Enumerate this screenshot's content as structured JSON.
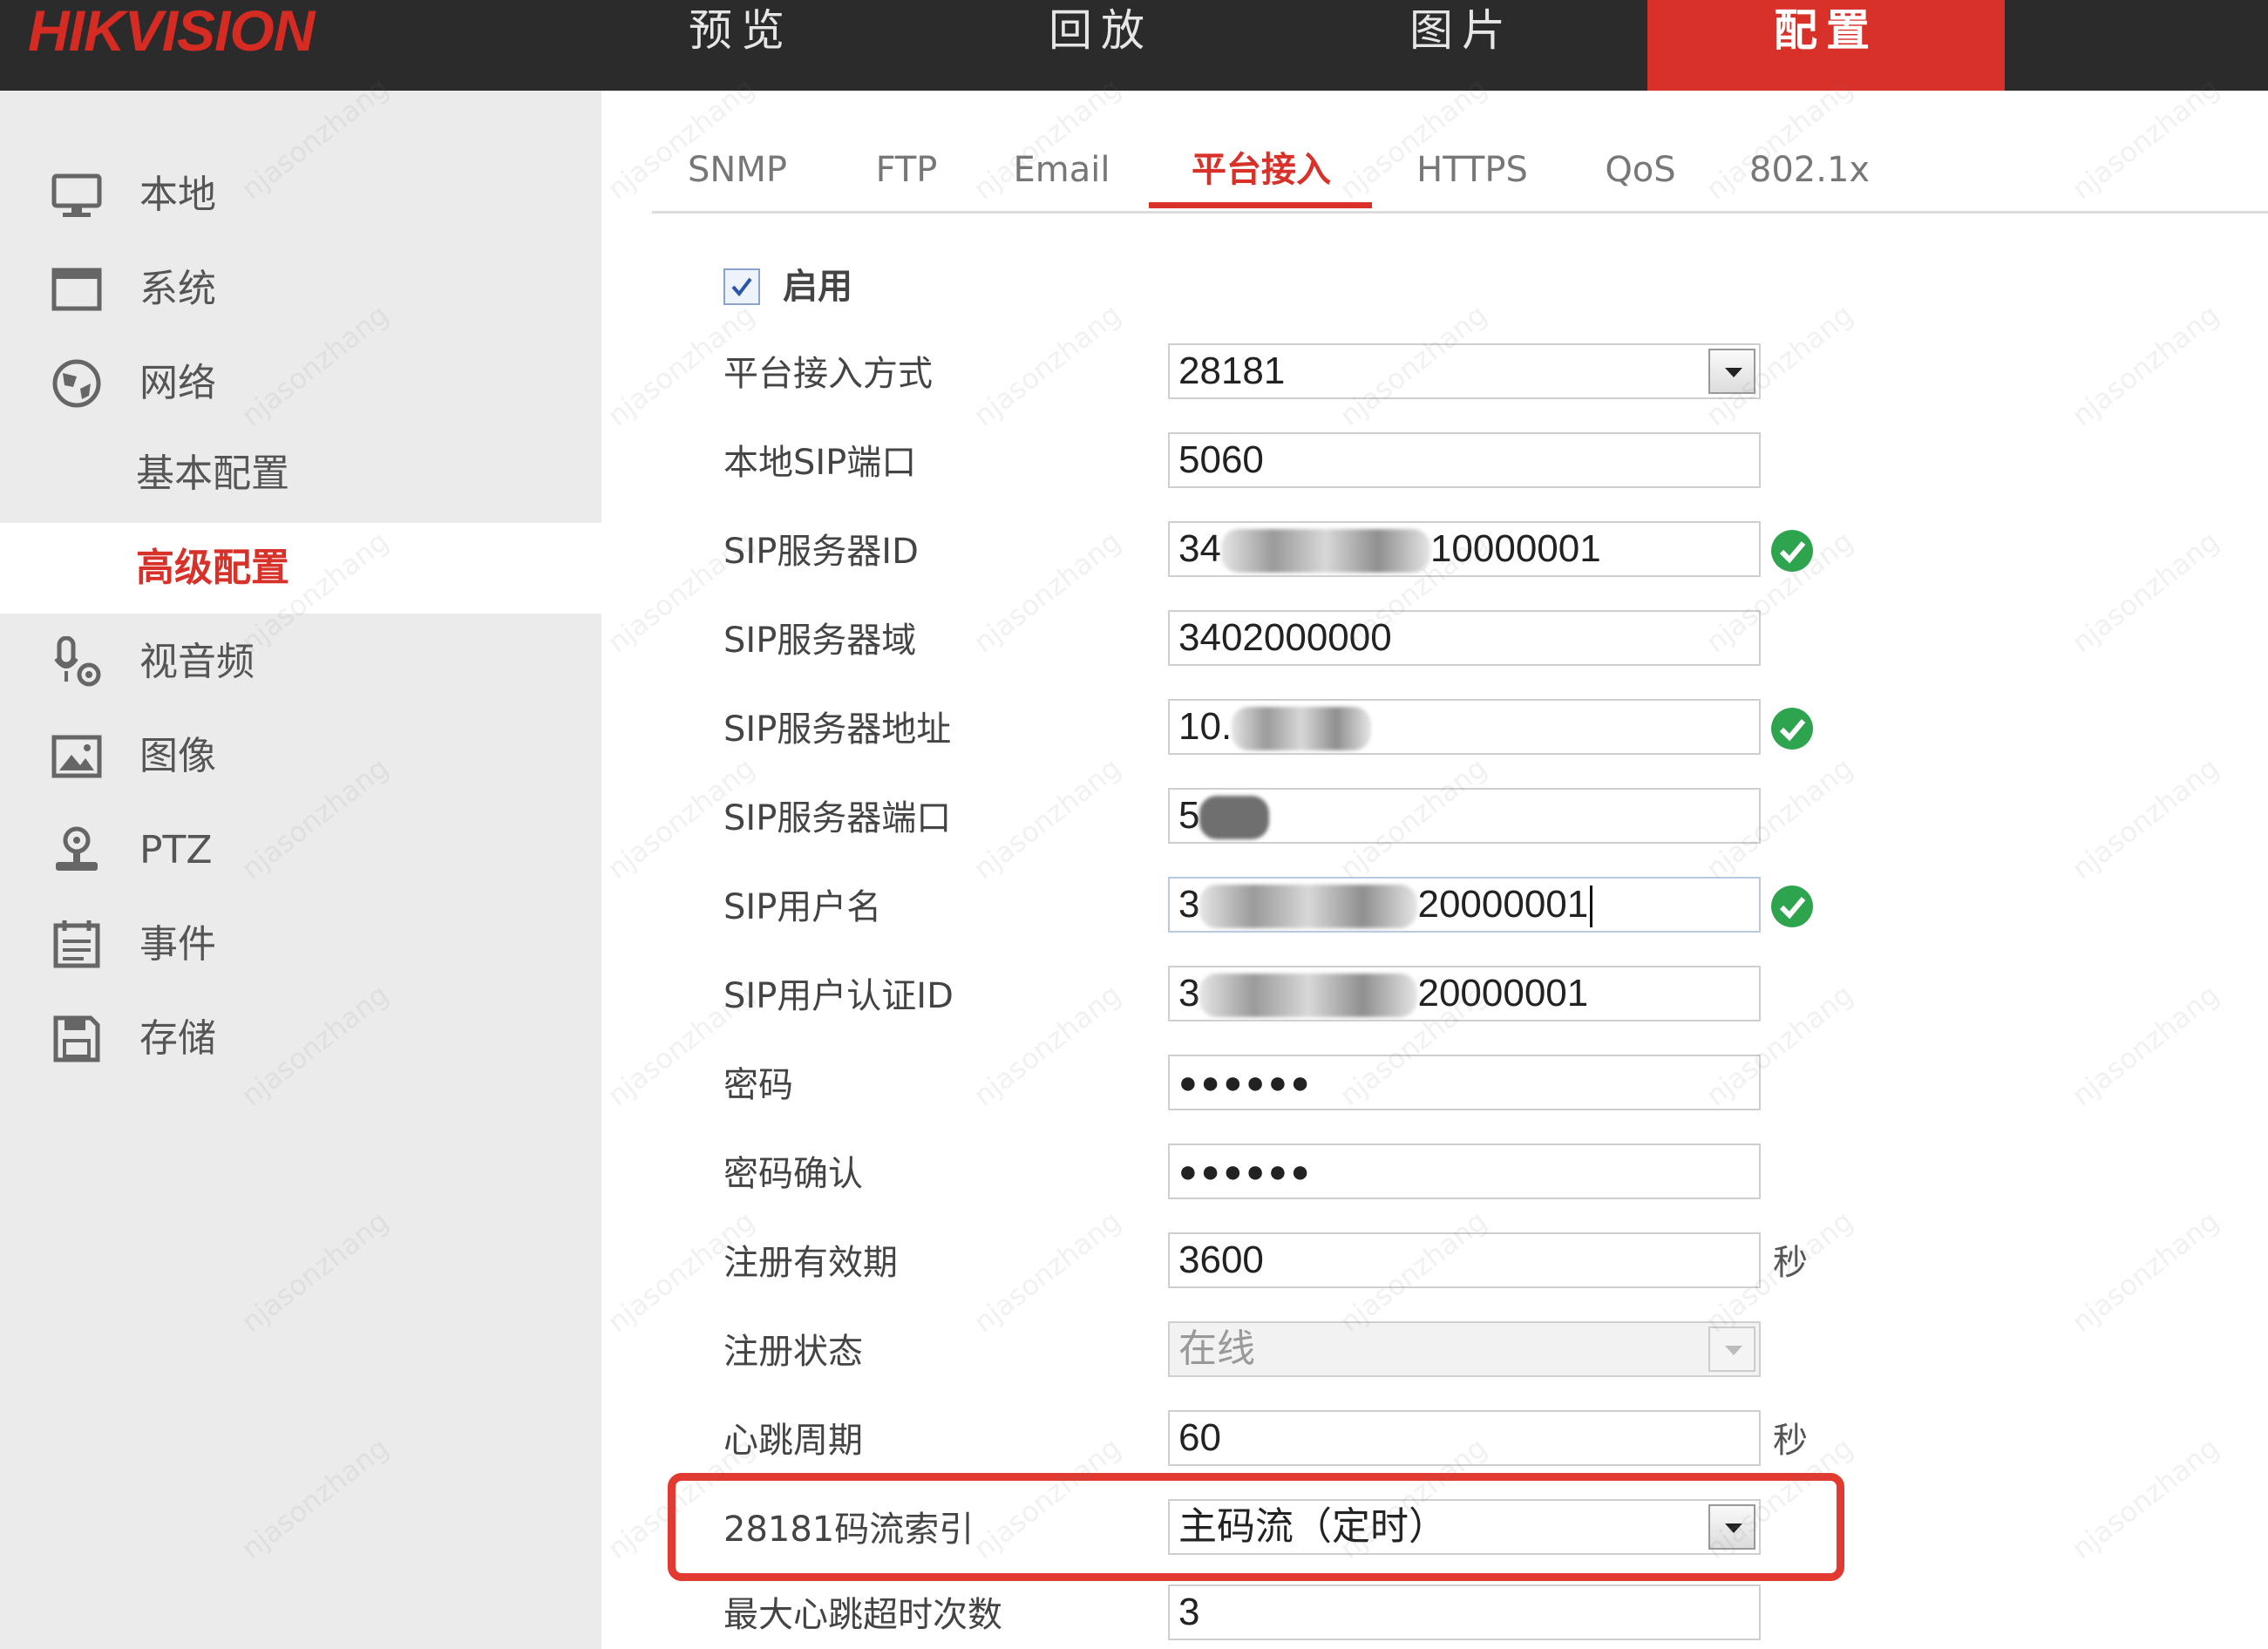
{
  "brand": {
    "name_hik": "HIK",
    "name_vision": "VISION"
  },
  "topnav": [
    {
      "label": "预览",
      "active": false
    },
    {
      "label": "回放",
      "active": false
    },
    {
      "label": "图片",
      "active": false
    },
    {
      "label": "配置",
      "active": true
    }
  ],
  "sidebar": {
    "items": [
      {
        "label": "本地",
        "icon": "monitor-icon"
      },
      {
        "label": "系统",
        "icon": "window-icon"
      },
      {
        "label": "网络",
        "icon": "globe-icon"
      },
      {
        "label": "视音频",
        "icon": "microphone-icon"
      },
      {
        "label": "图像",
        "icon": "image-icon"
      },
      {
        "label": "PTZ",
        "icon": "ptz-icon"
      },
      {
        "label": "事件",
        "icon": "calendar-icon"
      },
      {
        "label": "存储",
        "icon": "floppy-icon"
      }
    ],
    "subitems": [
      {
        "label": "基本配置",
        "active": false
      },
      {
        "label": "高级配置",
        "active": true
      }
    ]
  },
  "tabs": [
    {
      "label": "SNMP",
      "active": false
    },
    {
      "label": "FTP",
      "active": false
    },
    {
      "label": "Email",
      "active": false
    },
    {
      "label": "平台接入",
      "active": true
    },
    {
      "label": "HTTPS",
      "active": false
    },
    {
      "label": "QoS",
      "active": false
    },
    {
      "label": "802.1x",
      "active": false
    }
  ],
  "form": {
    "enable": {
      "label": "启用",
      "checked": true
    },
    "access_mode": {
      "label": "平台接入方式",
      "value": "28181"
    },
    "local_sip_port": {
      "label": "本地SIP端口",
      "value": "5060"
    },
    "sip_server_id": {
      "label": "SIP服务器ID",
      "value_prefix": "34",
      "value_suffix": "10000001"
    },
    "sip_server_domain": {
      "label": "SIP服务器域",
      "value": "3402000000"
    },
    "sip_server_addr": {
      "label": "SIP服务器地址",
      "value_prefix": "10."
    },
    "sip_server_port": {
      "label": "SIP服务器端口",
      "value_prefix": "5"
    },
    "sip_username": {
      "label": "SIP用户名",
      "value_prefix": "3",
      "value_suffix": "20000001"
    },
    "sip_auth_id": {
      "label": "SIP用户认证ID",
      "value_prefix": "3",
      "value_suffix": "20000001"
    },
    "password": {
      "label": "密码",
      "value": "●●●●●●"
    },
    "password_confirm": {
      "label": "密码确认",
      "value": "●●●●●●"
    },
    "reg_validity": {
      "label": "注册有效期",
      "value": "3600",
      "unit": "秒"
    },
    "reg_status": {
      "label": "注册状态",
      "value": "在线"
    },
    "heartbeat": {
      "label": "心跳周期",
      "value": "60",
      "unit": "秒"
    },
    "stream_index": {
      "label": "28181码流索引",
      "value": "主码流（定时）"
    },
    "max_heartbeat_timeout": {
      "label": "最大心跳超时次数",
      "value": "3"
    }
  },
  "colors": {
    "brand_red": "#d8312a",
    "ok_green": "#2ea44f",
    "highlight_red": "#e23a31"
  },
  "watermark": "njasonzhang"
}
